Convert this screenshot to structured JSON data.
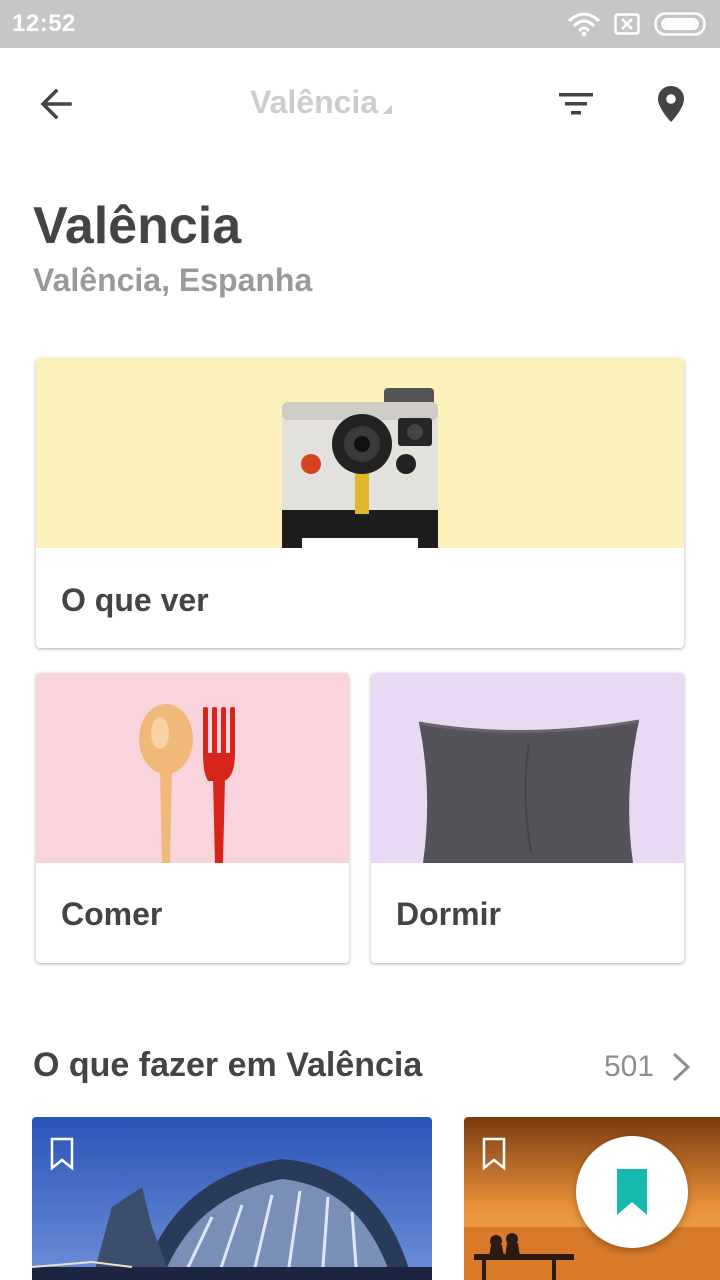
{
  "status_bar": {
    "time": "12:52",
    "icons": [
      "wifi-icon",
      "sim-blocked-icon",
      "battery-icon"
    ]
  },
  "app_bar": {
    "title": "Valência",
    "back_icon": "arrow-back-icon",
    "filter_icon": "filter-icon",
    "map_icon": "location-pin-icon"
  },
  "header": {
    "title": "Valência",
    "subtitle": "Valência, Espanha"
  },
  "categories": [
    {
      "label": "O que ver",
      "image": "instant-camera",
      "bg": "#fcf1bb"
    },
    {
      "label": "Comer",
      "image": "spoon-and-fork",
      "bg": "#fad4dd"
    },
    {
      "label": "Dormir",
      "image": "pillow",
      "bg": "#ead9f5"
    }
  ],
  "section": {
    "title": "O que fazer em Valência",
    "count": "501",
    "chevron_icon": "chevron-right-icon"
  },
  "colors": {
    "accent": "#17b8ae",
    "text_dark": "#444444",
    "text_muted": "#9a9a9a",
    "status_bar": "#c6c6c6"
  }
}
